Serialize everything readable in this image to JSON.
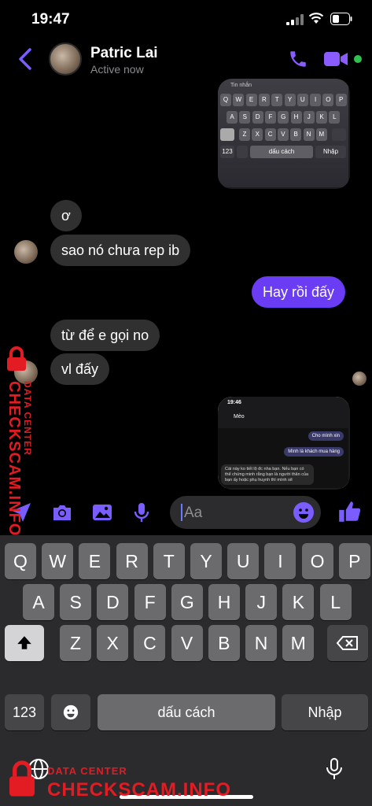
{
  "status": {
    "time": "19:47"
  },
  "header": {
    "name": "Patric Lai",
    "status": "Active now"
  },
  "messages": {
    "m1": "ơ",
    "m2": "sao nó chưa rep ib",
    "m3": "Hay rồi đấy",
    "m4": "từ để e gọi no",
    "m5": "vl đấy"
  },
  "mini_keyboard": {
    "input_placeholder": "Tin nhắn",
    "row1": [
      "Q",
      "W",
      "E",
      "R",
      "T",
      "Y",
      "U",
      "I",
      "O",
      "P"
    ],
    "row2": [
      "A",
      "S",
      "D",
      "F",
      "G",
      "H",
      "J",
      "K",
      "L"
    ],
    "row3": [
      "Z",
      "X",
      "C",
      "V",
      "B",
      "N",
      "M"
    ],
    "num": "123",
    "space": "dấu cách",
    "enter": "Nhập"
  },
  "mini_chat": {
    "time": "19:46",
    "name": "Mèo",
    "b1": "Cho mình xin",
    "b2": "Mình là khách mua hàng",
    "b2_time": "19:42",
    "b3": "Cái này ko tiết lộ đc nha bạn. Nếu bạn có thể chứng minh rằng bạn là người thân của bạn ấy hoặc phụ huynh thì mình sẽ"
  },
  "composer": {
    "placeholder": "Aa"
  },
  "keyboard": {
    "row1": [
      "Q",
      "W",
      "E",
      "R",
      "T",
      "Y",
      "U",
      "I",
      "O",
      "P"
    ],
    "row2": [
      "A",
      "S",
      "D",
      "F",
      "G",
      "H",
      "J",
      "K",
      "L"
    ],
    "row3": [
      "Z",
      "X",
      "C",
      "V",
      "B",
      "N",
      "M"
    ],
    "num": "123",
    "space": "dấu cách",
    "enter": "Nhập"
  },
  "watermark": {
    "line1": "DATA CENTER",
    "line2": "CHECKSCAM.INFO"
  },
  "colors": {
    "accent": "#6a3cf3",
    "icon": "#7b5cff",
    "bubble_other": "#303030",
    "online": "#31c24d"
  }
}
